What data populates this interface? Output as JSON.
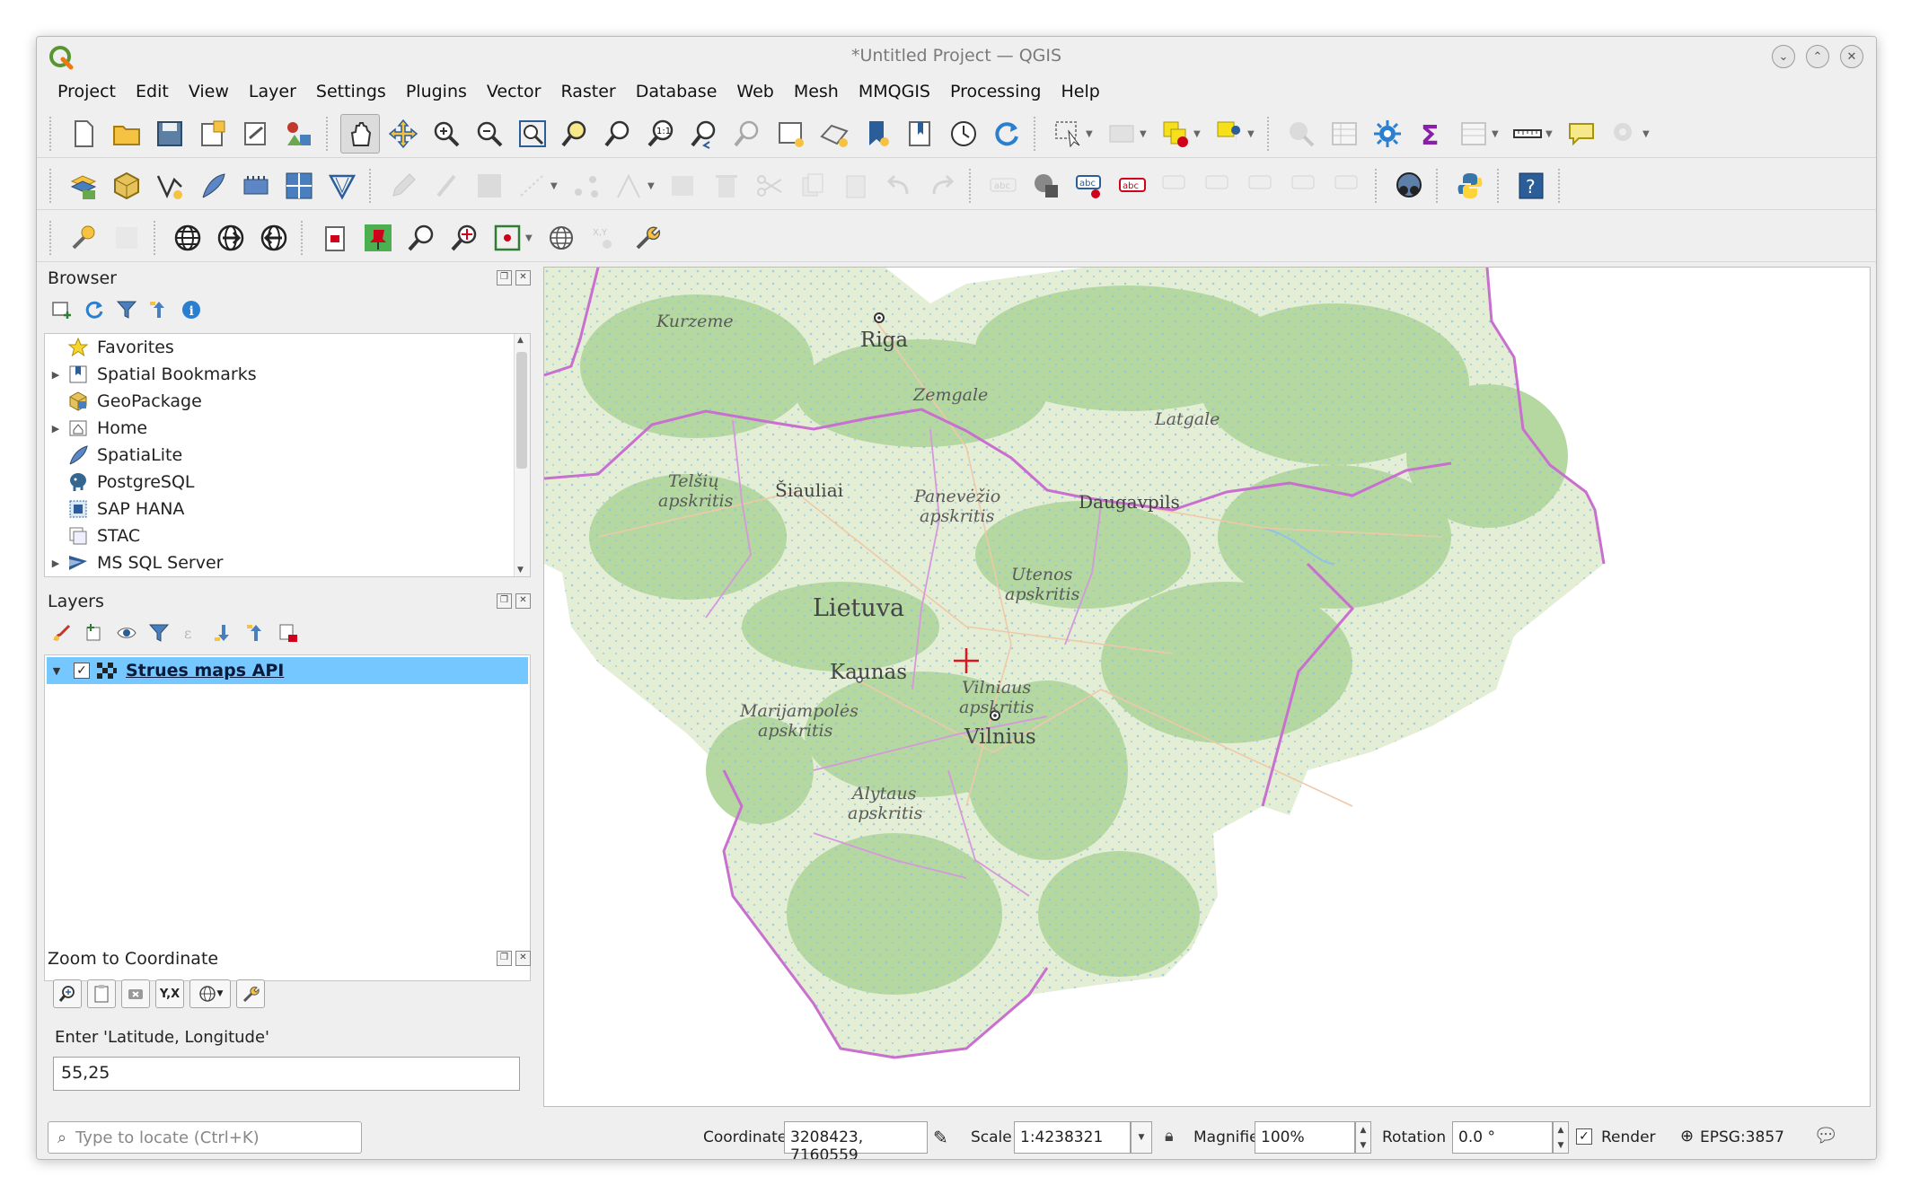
{
  "window": {
    "title": "*Untitled Project — QGIS"
  },
  "menu": [
    "Project",
    "Edit",
    "View",
    "Layer",
    "Settings",
    "Plugins",
    "Vector",
    "Raster",
    "Database",
    "Web",
    "Mesh",
    "MMQGIS",
    "Processing",
    "Help"
  ],
  "browser": {
    "title": "Browser",
    "items": [
      {
        "label": "Favorites",
        "icon": "star-icon",
        "expandable": false
      },
      {
        "label": "Spatial Bookmarks",
        "icon": "bookmark-icon",
        "expandable": true
      },
      {
        "label": "GeoPackage",
        "icon": "geopackage-icon",
        "expandable": false
      },
      {
        "label": "Home",
        "icon": "home-icon",
        "expandable": true
      },
      {
        "label": "SpatiaLite",
        "icon": "spatialite-icon",
        "expandable": false
      },
      {
        "label": "PostgreSQL",
        "icon": "postgresql-icon",
        "expandable": false
      },
      {
        "label": "SAP HANA",
        "icon": "sap-hana-icon",
        "expandable": false
      },
      {
        "label": "STAC",
        "icon": "stac-icon",
        "expandable": false
      },
      {
        "label": "MS SQL Server",
        "icon": "mssql-icon",
        "expandable": true
      }
    ]
  },
  "layers": {
    "title": "Layers",
    "items": [
      {
        "label": "Strues maps API",
        "checked": true
      }
    ]
  },
  "zoom": {
    "title": "Zoom to Coordinate",
    "prompt": "Enter 'Latitude, Longitude'",
    "value": "55,25",
    "yx_label": "Y,X"
  },
  "map": {
    "labels": [
      {
        "text": "Kurzeme",
        "italic": true
      },
      {
        "text": "Riga",
        "italic": false
      },
      {
        "text": "Zemgale",
        "italic": true
      },
      {
        "text": "Latgale",
        "italic": true
      },
      {
        "text": "Telšių",
        "italic": true
      },
      {
        "text": "apskritis",
        "italic": true
      },
      {
        "text": "Šiauliai",
        "italic": false
      },
      {
        "text": "Panevėžio",
        "italic": true
      },
      {
        "text": "apskritis",
        "italic": true
      },
      {
        "text": "Daugavpils",
        "italic": false
      },
      {
        "text": "Utenos",
        "italic": true
      },
      {
        "text": "apskritis",
        "italic": true
      },
      {
        "text": "Lietuva",
        "italic": false
      },
      {
        "text": "Kaunas",
        "italic": false
      },
      {
        "text": "Vilniaus",
        "italic": true
      },
      {
        "text": "apskritis",
        "italic": true
      },
      {
        "text": "Marijampolės",
        "italic": true
      },
      {
        "text": "apskritis",
        "italic": true
      },
      {
        "text": "Vilnius",
        "italic": false
      },
      {
        "text": "Alytaus",
        "italic": true
      },
      {
        "text": "apskritis",
        "italic": true
      }
    ]
  },
  "status": {
    "locate_placeholder": "Type to locate (Ctrl+K)",
    "coordinate_label": "Coordinate",
    "coordinate": "3208423, 7160559",
    "scale_label": "Scale",
    "scale": "1:4238321",
    "magnifier_label": "Magnifier",
    "magnifier": "100%",
    "rotation_label": "Rotation",
    "rotation": "0.0 °",
    "render_label": "Render",
    "crs": "EPSG:3857"
  },
  "colors": {
    "land": "#e9f1dc",
    "forest": "#aed59d",
    "water": "#8fc3e8",
    "border": "#c86fd0",
    "selection": "#75c7ff",
    "crosshair": "#e0141e"
  }
}
